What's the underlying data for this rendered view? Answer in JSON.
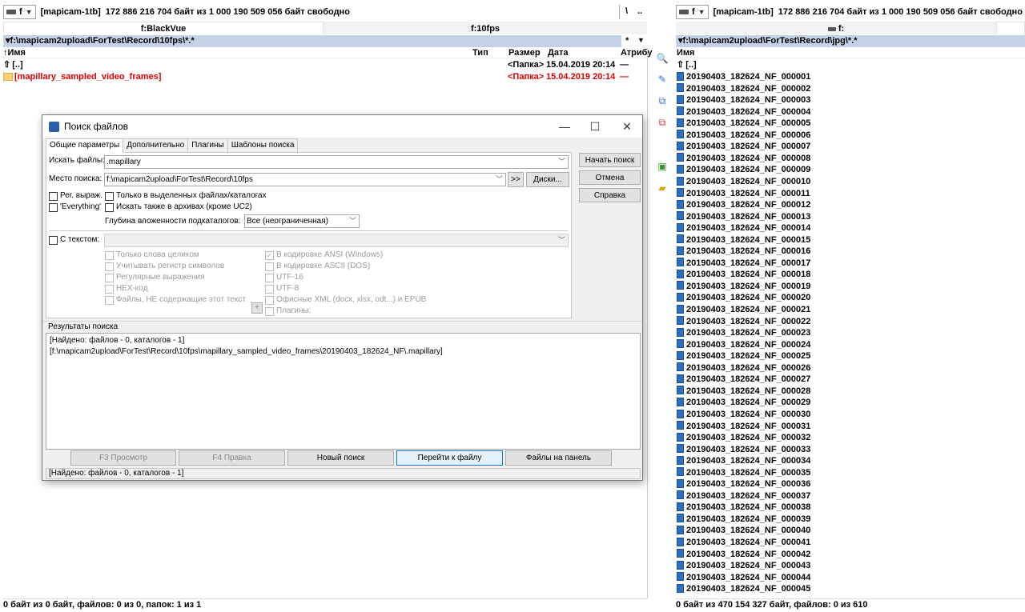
{
  "left_panel": {
    "drive_letter": "f",
    "drive_label": "[mapicam-1tb]",
    "drive_info": "172 886 216 704 байт из 1 000 190 509 056 байт свободно",
    "nav_root": "\\",
    "nav_up": "..",
    "tabs": [
      "f:BlackVue",
      "f:10fps"
    ],
    "path": "f:\\mapicam2upload\\ForTest\\Record\\10fps\\*.*",
    "path_star": "*",
    "columns": {
      "name": "Имя",
      "type": "Тип",
      "size": "Размер",
      "date": "Дата",
      "attr": "Атрибу"
    },
    "rows": [
      {
        "name": "[..]",
        "size": "<Папка>",
        "date": "15.04.2019 20:14",
        "attr": "—"
      },
      {
        "name": "[mapillary_sampled_video_frames]",
        "size": "<Папка>",
        "date": "15.04.2019 20:14",
        "attr": "—"
      }
    ],
    "status": "0 байт из 0 байт, файлов: 0 из 0, папок: 1 из 1"
  },
  "right_panel": {
    "drive_letter": "f",
    "drive_label": "[mapicam-1tb]",
    "drive_info": "172 886 216 704 байт из 1 000 190 509 056 байт свободно",
    "tab": "f:",
    "path": "f:\\mapicam2upload\\ForTest\\Record\\jpg\\*.*",
    "column_name": "Имя",
    "up_row": "[..]",
    "files": [
      "20190403_182624_NF_000001",
      "20190403_182624_NF_000002",
      "20190403_182624_NF_000003",
      "20190403_182624_NF_000004",
      "20190403_182624_NF_000005",
      "20190403_182624_NF_000006",
      "20190403_182624_NF_000007",
      "20190403_182624_NF_000008",
      "20190403_182624_NF_000009",
      "20190403_182624_NF_000010",
      "20190403_182624_NF_000011",
      "20190403_182624_NF_000012",
      "20190403_182624_NF_000013",
      "20190403_182624_NF_000014",
      "20190403_182624_NF_000015",
      "20190403_182624_NF_000016",
      "20190403_182624_NF_000017",
      "20190403_182624_NF_000018",
      "20190403_182624_NF_000019",
      "20190403_182624_NF_000020",
      "20190403_182624_NF_000021",
      "20190403_182624_NF_000022",
      "20190403_182624_NF_000023",
      "20190403_182624_NF_000024",
      "20190403_182624_NF_000025",
      "20190403_182624_NF_000026",
      "20190403_182624_NF_000027",
      "20190403_182624_NF_000028",
      "20190403_182624_NF_000029",
      "20190403_182624_NF_000030",
      "20190403_182624_NF_000031",
      "20190403_182624_NF_000032",
      "20190403_182624_NF_000033",
      "20190403_182624_NF_000034",
      "20190403_182624_NF_000035",
      "20190403_182624_NF_000036",
      "20190403_182624_NF_000037",
      "20190403_182624_NF_000038",
      "20190403_182624_NF_000039",
      "20190403_182624_NF_000040",
      "20190403_182624_NF_000041",
      "20190403_182624_NF_000042",
      "20190403_182624_NF_000043",
      "20190403_182624_NF_000044",
      "20190403_182624_NF_000045"
    ],
    "status": "0 байт из 470 154 327 байт, файлов: 0 из 610"
  },
  "toolbar_icons": [
    "search-icon",
    "edit-icon",
    "copy-icon",
    "compare-icon",
    "pack-icon",
    "new-folder-icon"
  ],
  "dialog": {
    "title": "Поиск файлов",
    "tabs": [
      "Общие параметры",
      "Дополнительно",
      "Плагины",
      "Шаблоны поиска"
    ],
    "search_label": "Искать файлы:",
    "search_value": ".mapillary",
    "location_label": "Место поиска:",
    "location_value": "f:\\mapicam2upload\\ForTest\\Record\\10fps",
    "more_btn": ">>",
    "disks_btn": "Диски...",
    "regex_label": "Рег. выраж.",
    "only_selected_label": "Только в выделенных файлах/каталогах",
    "everything_label": "'Everything'",
    "archives_label": "Искать также в архивах (кроме UC2)",
    "depth_label": "Глубина вложенности подкаталогов:",
    "depth_value": "Все (неограниченная)",
    "with_text_label": "С текстом:",
    "text_options_left": [
      "Только слова целиком",
      "Учитывать регистр символов",
      "Регулярные выражения",
      "HEX-код",
      "Файлы, НЕ содержащие этот текст"
    ],
    "text_options_right": [
      "В кодировке ANSI (Windows)",
      "В кодировке ASCII (DOS)",
      "UTF-16",
      "UTF-8",
      "Офисные XML (docx, xlsx, odt...) и EPUB",
      "Плагины:"
    ],
    "plus_btn": "+",
    "start_btn": "Начать поиск",
    "cancel_btn": "Отмена",
    "help_btn": "Справка",
    "results_label": "Результаты поиска",
    "results": [
      "[Найдено: файлов - 0, каталогов - 1]",
      "[f:\\mapicam2upload\\ForTest\\Record\\10fps\\mapillary_sampled_video_frames\\20190403_182624_NF\\.mapillary]"
    ],
    "bottom_buttons": [
      "F3 Просмотр",
      "F4 Правка",
      "Новый поиск",
      "Перейти к файлу",
      "Файлы на панель"
    ],
    "status": "[Найдено: файлов - 0, каталогов - 1]",
    "window_buttons": [
      "—",
      "☐",
      "✕"
    ]
  },
  "colors": {
    "path_bar": "#c3d2e4",
    "folder_red": "#e00000",
    "accent": "#0078d7"
  }
}
